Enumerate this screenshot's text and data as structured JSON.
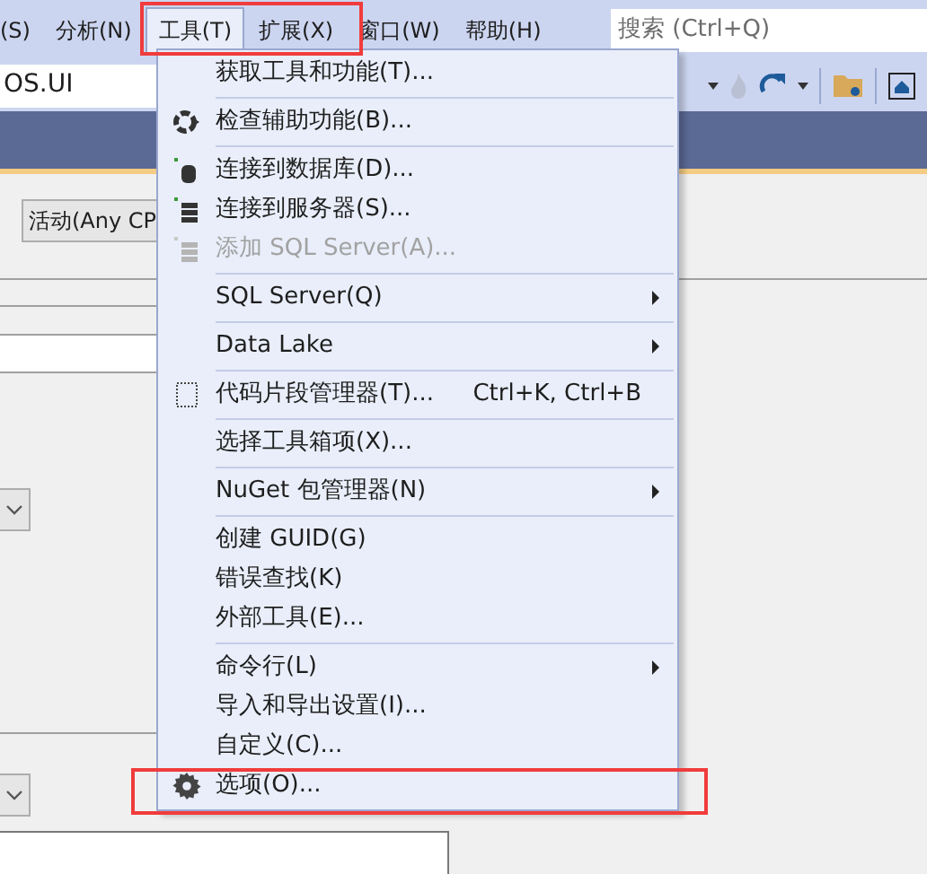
{
  "menu_bar": {
    "items": [
      {
        "label": "(S)",
        "selected": false
      },
      {
        "label": "分析(N)",
        "selected": false
      },
      {
        "label": "工具(T)",
        "selected": true
      },
      {
        "label": "扩展(X)",
        "selected": false
      },
      {
        "label": "窗口(W)",
        "selected": false
      },
      {
        "label": "帮助(H)",
        "selected": false
      }
    ],
    "search": {
      "placeholder": "搜索 (Ctrl+Q)"
    }
  },
  "toolbar": {
    "project_field": "OS.UI"
  },
  "config": {
    "platform": "活动(Any CP"
  },
  "tools_menu": {
    "items": [
      {
        "kind": "item",
        "label": "获取工具和功能(T)...",
        "disabled": false,
        "submenu": false
      },
      {
        "kind": "separator"
      },
      {
        "kind": "item",
        "label": "检查辅助功能(B)...",
        "disabled": false,
        "submenu": false
      },
      {
        "kind": "separator"
      },
      {
        "kind": "item",
        "label": "连接到数据库(D)...",
        "disabled": false,
        "submenu": false
      },
      {
        "kind": "item",
        "label": "连接到服务器(S)...",
        "disabled": false,
        "submenu": false
      },
      {
        "kind": "item",
        "label": "添加 SQL Server(A)...",
        "disabled": true,
        "submenu": false
      },
      {
        "kind": "separator"
      },
      {
        "kind": "item",
        "label": "SQL Server(Q)",
        "disabled": false,
        "submenu": true
      },
      {
        "kind": "separator"
      },
      {
        "kind": "item",
        "label": "Data Lake",
        "disabled": false,
        "submenu": true
      },
      {
        "kind": "separator"
      },
      {
        "kind": "item",
        "label": "代码片段管理器(T)...",
        "shortcut": "Ctrl+K, Ctrl+B",
        "disabled": false,
        "submenu": false
      },
      {
        "kind": "separator"
      },
      {
        "kind": "item",
        "label": "选择工具箱项(X)...",
        "disabled": false,
        "submenu": false
      },
      {
        "kind": "separator"
      },
      {
        "kind": "item",
        "label": "NuGet 包管理器(N)",
        "disabled": false,
        "submenu": true
      },
      {
        "kind": "separator"
      },
      {
        "kind": "item",
        "label": "创建 GUID(G)",
        "disabled": false,
        "submenu": false
      },
      {
        "kind": "item",
        "label": "错误查找(K)",
        "disabled": false,
        "submenu": false
      },
      {
        "kind": "item",
        "label": "外部工具(E)...",
        "disabled": false,
        "submenu": false
      },
      {
        "kind": "separator"
      },
      {
        "kind": "item",
        "label": "命令行(L)",
        "disabled": false,
        "submenu": true
      },
      {
        "kind": "item",
        "label": "导入和导出设置(I)...",
        "disabled": false,
        "submenu": false
      },
      {
        "kind": "item",
        "label": "自定义(C)...",
        "disabled": false,
        "submenu": false
      },
      {
        "kind": "item",
        "label": "选项(O)...",
        "disabled": false,
        "submenu": false
      }
    ]
  }
}
